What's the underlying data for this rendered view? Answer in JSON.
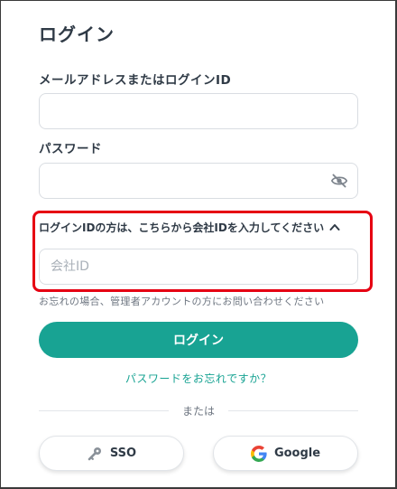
{
  "page": {
    "title": "ログイン"
  },
  "email": {
    "label": "メールアドレスまたはログインID",
    "value": "",
    "placeholder": ""
  },
  "password": {
    "label": "パスワード",
    "value": "",
    "placeholder": "",
    "visibility_icon": "eye-off-icon"
  },
  "company": {
    "toggle_label": "ログインIDの方は、こちらから会社IDを入力してください",
    "toggle_icon": "chevron-up-icon",
    "placeholder": "会社ID",
    "value": "",
    "note": "お忘れの場合、管理者アカウントの方にお問い合わせください"
  },
  "actions": {
    "login_label": "ログイン",
    "forgot_label": "パスワードをお忘れですか？",
    "divider_label": "または"
  },
  "alt_logins": {
    "sso_label": "SSO",
    "sso_icon": "key-icon",
    "google_label": "Google",
    "google_icon": "google-logo-icon"
  },
  "colors": {
    "accent": "#18a393",
    "highlight": "#e60012",
    "text": "#2f3a46"
  }
}
